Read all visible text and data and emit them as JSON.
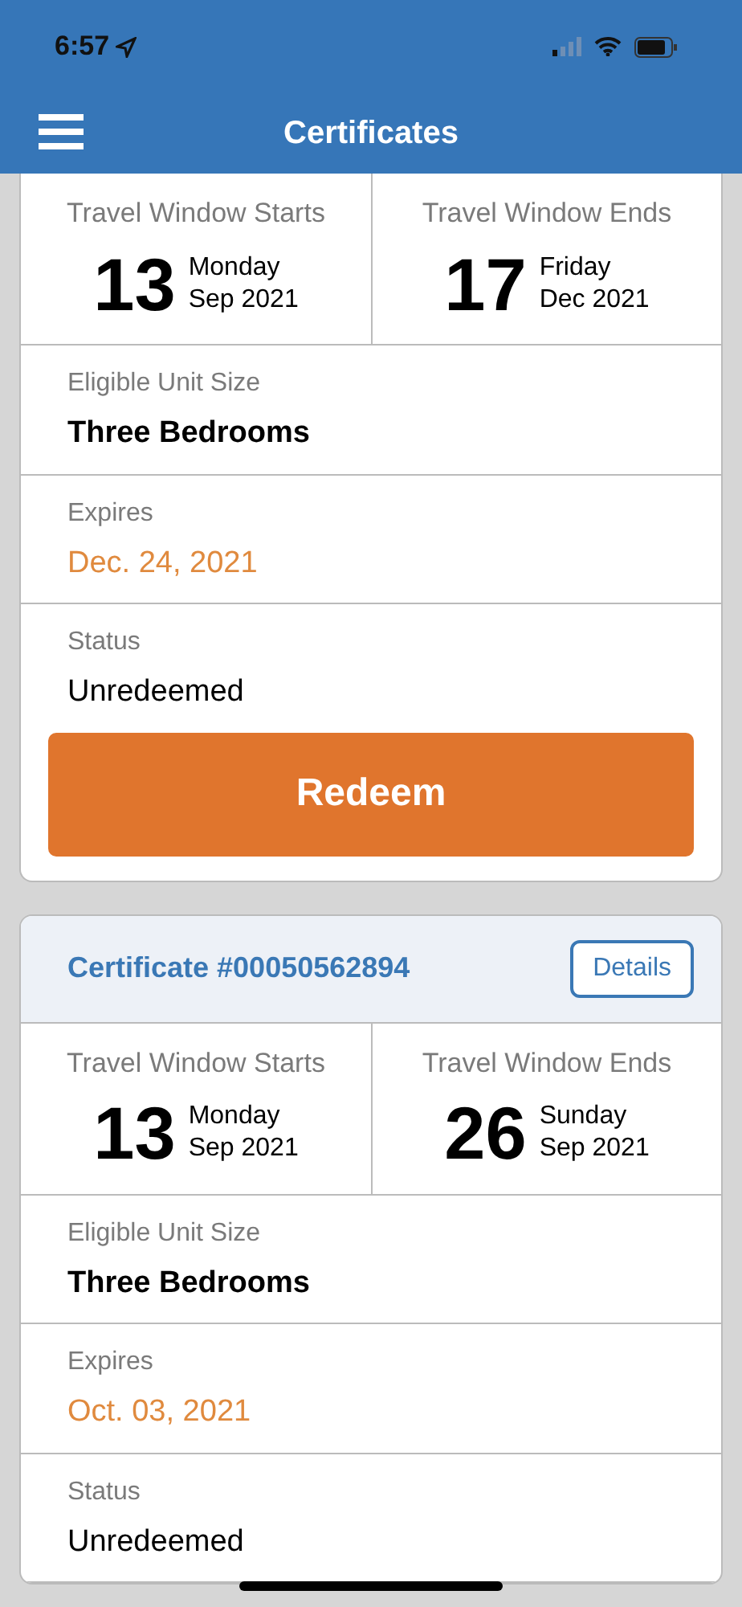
{
  "status_bar": {
    "time": "6:57"
  },
  "nav": {
    "title": "Certificates"
  },
  "certificates": [
    {
      "windows": [
        {
          "label": "Travel Window Starts",
          "day": "13",
          "weekday": "Monday",
          "month": "Sep 2021"
        },
        {
          "label": "Travel Window Ends",
          "day": "17",
          "weekday": "Friday",
          "month": "Dec 2021"
        }
      ],
      "fields": [
        {
          "kind": "unit",
          "label": "Eligible Unit Size",
          "value": "Three Bedrooms"
        },
        {
          "kind": "expiry",
          "label": "Expires",
          "value": "Dec. 24, 2021"
        },
        {
          "kind": "status",
          "label": "Status",
          "value": "Unredeemed"
        }
      ],
      "action": "Redeem"
    },
    {
      "header": {
        "title": "Certificate #00050562894",
        "button": "Details"
      },
      "windows": [
        {
          "label": "Travel Window Starts",
          "day": "13",
          "weekday": "Monday",
          "month": "Sep 2021"
        },
        {
          "label": "Travel Window Ends",
          "day": "26",
          "weekday": "Sunday",
          "month": "Sep 2021"
        }
      ],
      "fields": [
        {
          "kind": "unit",
          "label": "Eligible Unit Size",
          "value": "Three Bedrooms"
        },
        {
          "kind": "expiry",
          "label": "Expires",
          "value": "Oct. 03, 2021"
        },
        {
          "kind": "status",
          "label": "Status",
          "value": "Unredeemed"
        }
      ]
    }
  ]
}
